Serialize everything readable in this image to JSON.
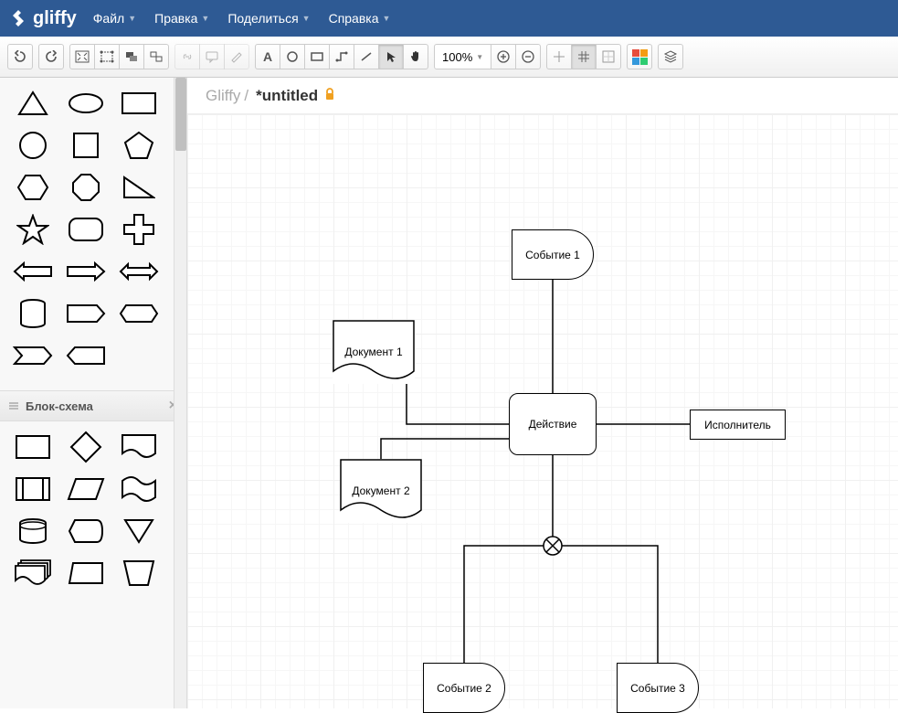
{
  "brand": "gliffy",
  "menu": {
    "file": "Файл",
    "edit": "Правка",
    "share": "Поделиться",
    "help": "Справка"
  },
  "toolbar": {
    "zoom": "100%"
  },
  "breadcrumb": {
    "app": "Gliffy",
    "sep": "/",
    "doc": "*untitled"
  },
  "sidebar": {
    "panel_flowchart": "Блок-схема"
  },
  "canvas": {
    "event1": "Событие 1",
    "doc1": "Документ 1",
    "action": "Действие",
    "executor": "Исполнитель",
    "doc2": "Документ 2",
    "event2": "Событие 2",
    "event3": "Событие 3"
  }
}
